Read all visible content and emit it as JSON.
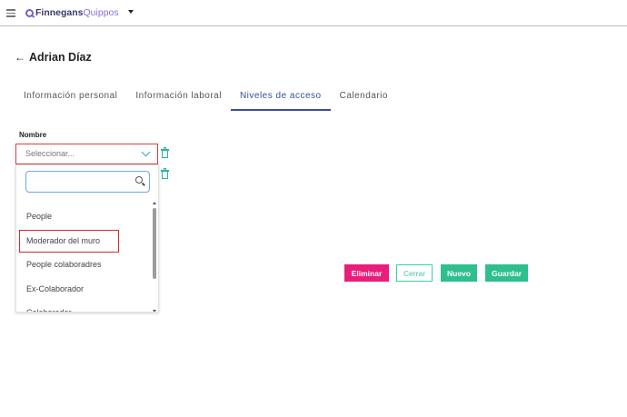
{
  "app": {
    "brand_part1": "Finnegans",
    "brand_part2": "Quippos"
  },
  "page": {
    "back_title": "Adrian Díaz"
  },
  "tabs": [
    {
      "label": "Información personal",
      "active": false
    },
    {
      "label": "Información laboral",
      "active": false
    },
    {
      "label": "Niveles de acceso",
      "active": true
    },
    {
      "label": "Calendario",
      "active": false
    }
  ],
  "form": {
    "field_label": "Nombre",
    "select_placeholder": "Seleccionar...",
    "search_value": ""
  },
  "dropdown": {
    "options": [
      "People",
      "Moderador del muro",
      "People colaboradres",
      "Ex-Colaborador",
      "Colaborador"
    ],
    "highlighted_index": 1
  },
  "actions": {
    "eliminar": "Eliminar",
    "cerrar": "Cerrar",
    "nuevo": "Nuevo",
    "guardar": "Guardar"
  },
  "colors": {
    "accent": "#3a4e9a",
    "danger": "#e91e7a",
    "success": "#2fbf8c",
    "highlight_border": "#d92b2b"
  },
  "icons": [
    "menu-icon",
    "logo-icon",
    "caret-down-icon",
    "arrow-left-icon",
    "chevron-down-icon",
    "trash-icon",
    "search-icon"
  ]
}
